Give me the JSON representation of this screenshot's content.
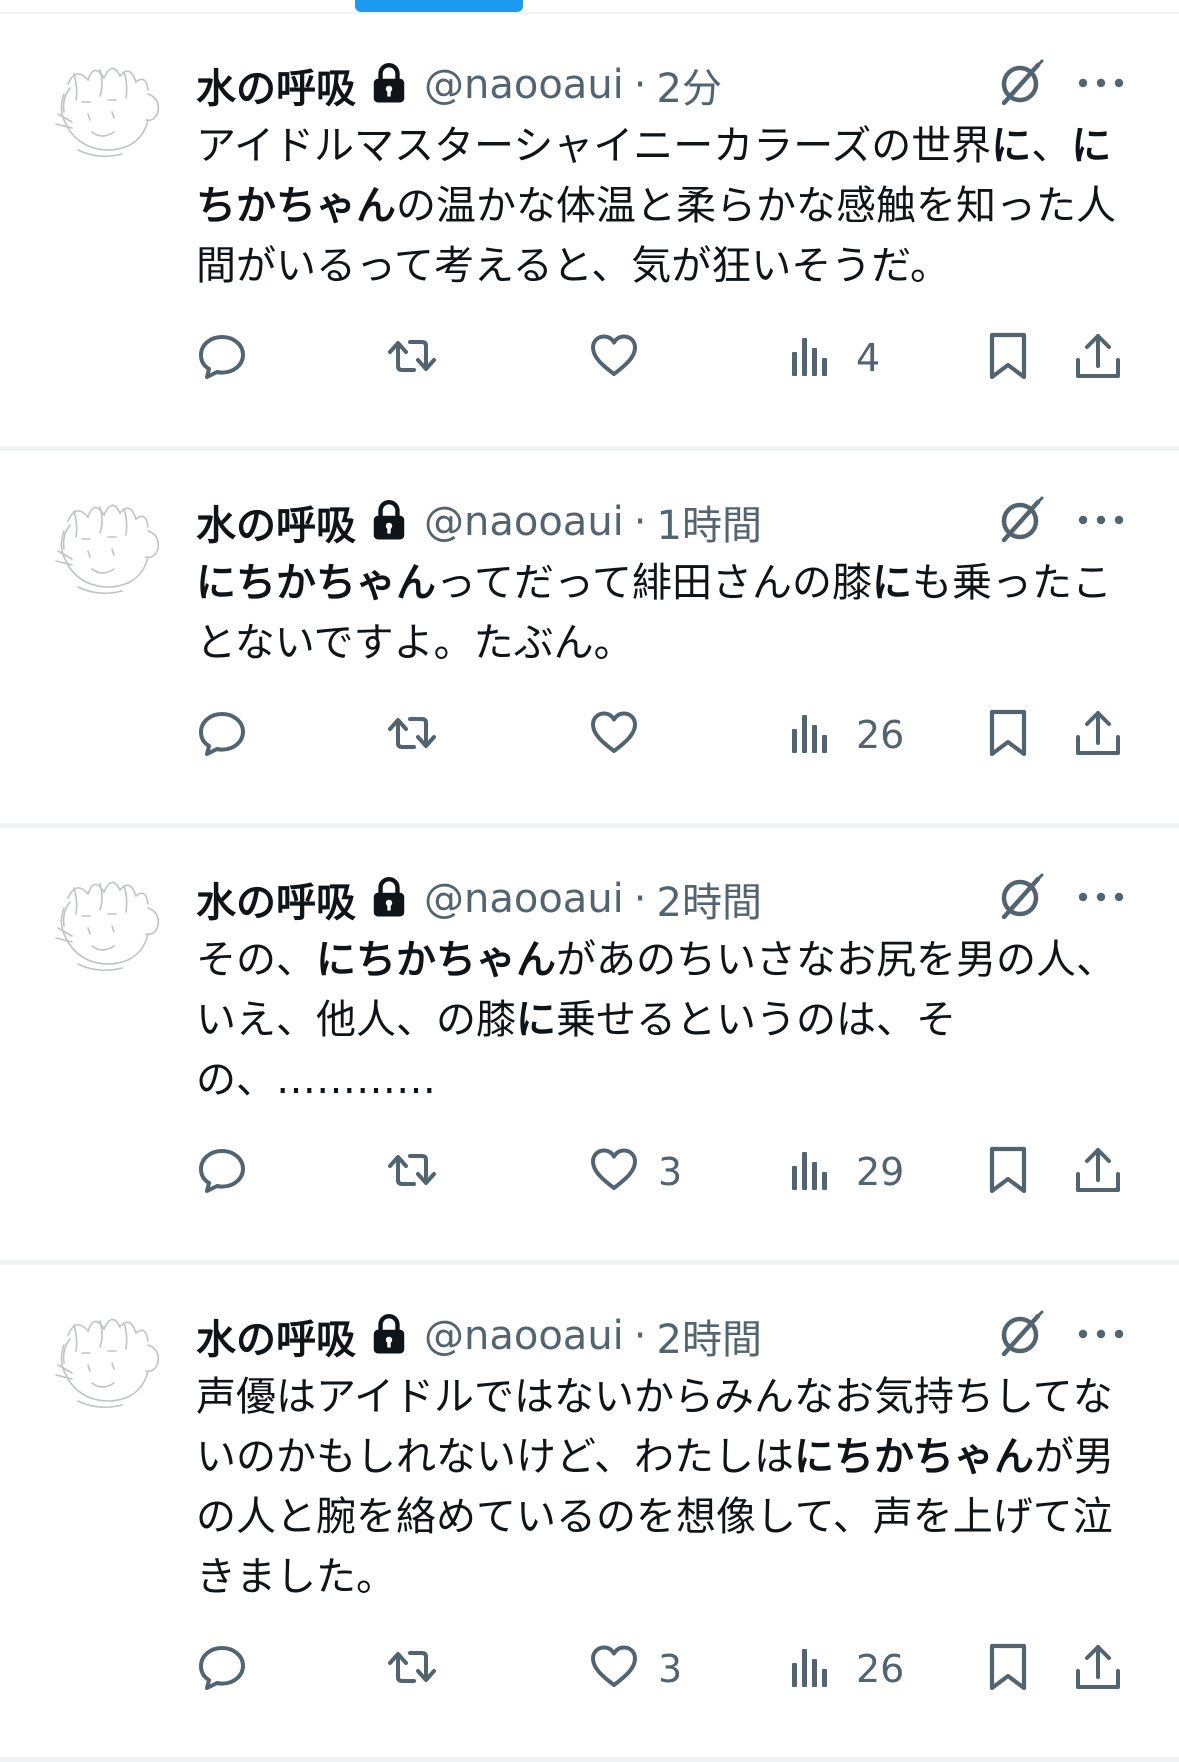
{
  "colors": {
    "accent": "#1d9bf0",
    "text": "#0f1419",
    "secondary": "#536471",
    "divider": "#eff3f4"
  },
  "tweets": [
    {
      "display_name": "水の呼吸",
      "handle": "@naooaui",
      "separator": "·",
      "time": "2分",
      "text_segments": [
        {
          "t": "アイドルマスターシャイニーカラーズの世界",
          "b": false
        },
        {
          "t": "に",
          "b": true
        },
        {
          "t": "、",
          "b": false
        },
        {
          "t": "にちかちゃん",
          "b": true
        },
        {
          "t": "の温かな体温と柔らかな感触を知った人間がいるって考えると、気が狂いそうだ。",
          "b": false
        }
      ],
      "counts": {
        "reply": "",
        "retweet": "",
        "like": "",
        "views": "4"
      }
    },
    {
      "display_name": "水の呼吸",
      "handle": "@naooaui",
      "separator": "·",
      "time": "1時間",
      "text_segments": [
        {
          "t": "にちかちゃん",
          "b": true
        },
        {
          "t": "ってだって緋田さんの膝",
          "b": false
        },
        {
          "t": "に",
          "b": true
        },
        {
          "t": "も乗ったことないですよ。たぶん。",
          "b": false
        }
      ],
      "counts": {
        "reply": "",
        "retweet": "",
        "like": "",
        "views": "26"
      }
    },
    {
      "display_name": "水の呼吸",
      "handle": "@naooaui",
      "separator": "·",
      "time": "2時間",
      "text_segments": [
        {
          "t": "その、",
          "b": false
        },
        {
          "t": "にちかちゃん",
          "b": true
        },
        {
          "t": "があのちいさなお尻を男の人、いえ、他人、の膝",
          "b": false
        },
        {
          "t": "に",
          "b": true
        },
        {
          "t": "乗せるというのは、その、…………",
          "b": false
        }
      ],
      "counts": {
        "reply": "",
        "retweet": "",
        "like": "3",
        "views": "29"
      }
    },
    {
      "display_name": "水の呼吸",
      "handle": "@naooaui",
      "separator": "·",
      "time": "2時間",
      "text_segments": [
        {
          "t": "声優はアイドルではないからみんなお気持ちしてないのかもしれないけど、わたしは",
          "b": false
        },
        {
          "t": "にちかちゃん",
          "b": true
        },
        {
          "t": "が男の人と腕を絡めているのを想像して、声を上げて泣きました。",
          "b": false
        }
      ],
      "counts": {
        "reply": "",
        "retweet": "",
        "like": "3",
        "views": "26"
      }
    }
  ]
}
